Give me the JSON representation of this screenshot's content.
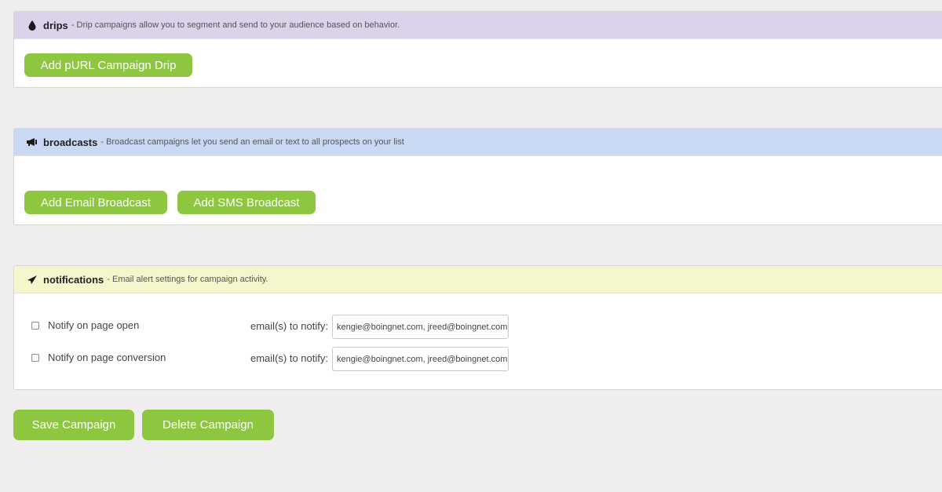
{
  "drips": {
    "title": "drips",
    "description": "- Drip campaigns allow you to segment and send to your audience based on behavior.",
    "icon": "drop-icon",
    "header_color": "#dbd3ea",
    "add_button": "Add pURL Campaign Drip"
  },
  "broadcasts": {
    "title": "broadcasts",
    "description": "- Broadcast campaigns let you send an email or text to all prospects on your list",
    "icon": "megaphone-icon",
    "header_color": "#c9d9f4",
    "email_button": "Add Email Broadcast",
    "sms_button": "Add SMS Broadcast"
  },
  "notifications": {
    "title": "notifications",
    "description": "- Email alert settings for campaign activity.",
    "icon": "paper-plane-icon",
    "header_color": "#f6f6cd",
    "rows": [
      {
        "label": "Notify on page open",
        "checked": false,
        "email_label": "email(s) to notify:",
        "email_value": "kengie@boingnet.com, jreed@boingnet.com,"
      },
      {
        "label": "Notify on page conversion",
        "checked": false,
        "email_label": "email(s) to notify:",
        "email_value": "kengie@boingnet.com, jreed@boingnet.com,"
      }
    ]
  },
  "actions": {
    "save": "Save Campaign",
    "delete": "Delete Campaign"
  },
  "colors": {
    "accent_green": "#8dc63f",
    "page_background": "#efeded"
  }
}
